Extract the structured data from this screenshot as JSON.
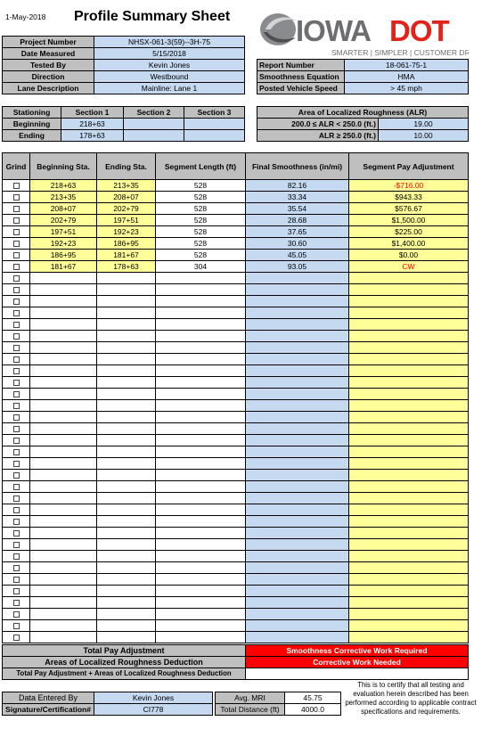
{
  "header": {
    "date": "1-May-2018",
    "title": "Profile Summary Sheet",
    "logo_text_iowa": "IOWA",
    "logo_text_dot": "DOT",
    "tagline": "SMARTER | SIMPLER | CUSTOMER DRIVEN"
  },
  "info": {
    "project_number_label": "Project Number",
    "project_number": "NHSX-061-3(59)--3H-75",
    "date_measured_label": "Date Measured",
    "date_measured": "5/15/2018",
    "tested_by_label": "Tested By",
    "tested_by": "Kevin Jones",
    "direction_label": "Direction",
    "direction": "Westbound",
    "lane_label": "Lane Description",
    "lane": "Mainline: Lane 1"
  },
  "report": {
    "report_number_label": "Report Number",
    "report_number": "18-061-75-1",
    "equation_label": "Smoothness Equation",
    "equation": "HMA",
    "speed_label": "Posted Vehicle Speed",
    "speed": "> 45 mph"
  },
  "stationing": {
    "title": "Stationing",
    "sections": [
      "Section 1",
      "Section 2",
      "Section 3"
    ],
    "beginning_label": "Beginning",
    "ending_label": "Ending",
    "beginning": [
      "218+63",
      "",
      ""
    ],
    "ending": [
      "178+63",
      "",
      ""
    ]
  },
  "alr": {
    "title": "Area of Localized Roughness (ALR)",
    "row1_label": "200.0 ≤ ALR < 250.0 (ft.)",
    "row1_value": "19.00",
    "row2_label": "ALR ≥ 250.0 (ft.)",
    "row2_value": "10.00"
  },
  "grid": {
    "headers": [
      "Grind",
      "Beginning Sta.",
      "Ending Sta.",
      "Segment Length (ft)",
      "Final Smoothness (in/mi)",
      "Segment Pay Adjustment"
    ],
    "rows": [
      {
        "begin": "218+63",
        "end": "213+35",
        "length": "528",
        "smooth": "82.16",
        "pay": "-$716.00",
        "neg": true
      },
      {
        "begin": "213+35",
        "end": "208+07",
        "length": "528",
        "smooth": "33.34",
        "pay": "$943.33"
      },
      {
        "begin": "208+07",
        "end": "202+79",
        "length": "528",
        "smooth": "35.54",
        "pay": "$576.67"
      },
      {
        "begin": "202+79",
        "end": "197+51",
        "length": "528",
        "smooth": "28.68",
        "pay": "$1,500.00"
      },
      {
        "begin": "197+51",
        "end": "192+23",
        "length": "528",
        "smooth": "37.65",
        "pay": "$225.00"
      },
      {
        "begin": "192+23",
        "end": "186+95",
        "length": "528",
        "smooth": "30.60",
        "pay": "$1,400.00"
      },
      {
        "begin": "186+95",
        "end": "181+67",
        "length": "528",
        "smooth": "45.05",
        "pay": "$0.00"
      },
      {
        "begin": "181+67",
        "end": "178+63",
        "length": "304",
        "smooth": "93.05",
        "pay": "CW",
        "cw": true
      }
    ],
    "empty_rows": 32
  },
  "totals": {
    "total_pay_label": "Total Pay Adjustment",
    "total_pay_value": "Smoothness Corrective Work Required",
    "alr_deduction_label": "Areas of Localized Roughness Deduction",
    "alr_deduction_value": "Corrective Work Needed",
    "combined_label": "Total Pay Adjustment + Areas of Localized Roughness Deduction",
    "combined_value": ""
  },
  "footer": {
    "entered_by_label": "Data Entered By",
    "entered_by": "Kevin Jones",
    "signature_label": "Signature/Certification#",
    "signature": "CI778",
    "avg_mri_label": "Avg. MRI",
    "avg_mri": "45.75",
    "total_distance_label": "Total Distance (ft)",
    "total_distance": "4000.0",
    "certification": "This is to certify that all testing and evaluation herein described has been performed according to applicable contract specifications and requirements."
  },
  "colors": {
    "label_gray": "#bfbfbf",
    "value_blue": "#c5d9f1",
    "pay_yellow": "#ffff99",
    "alert_red": "#ff0000",
    "logo_red": "#e2231a",
    "logo_gray": "#6d6e71"
  }
}
